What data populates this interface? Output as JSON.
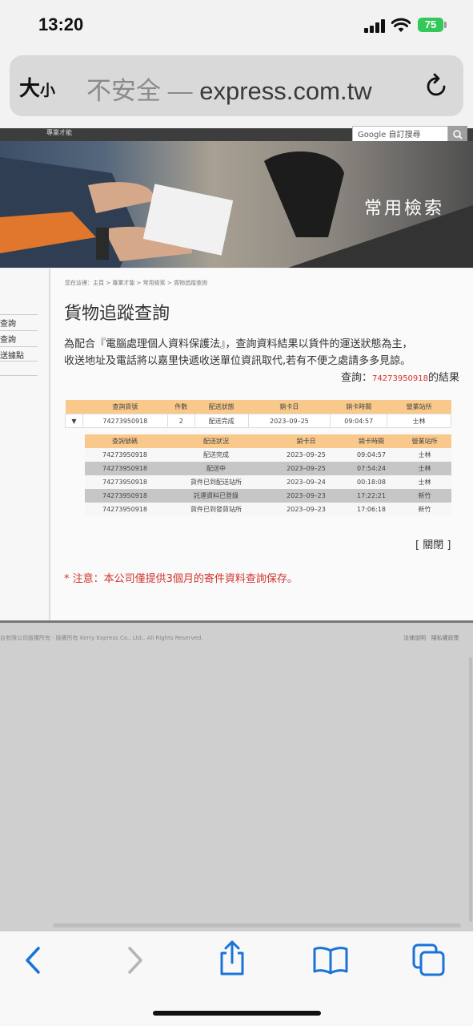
{
  "status_bar": {
    "time": "13:20",
    "battery": "75"
  },
  "browser": {
    "text_size": "大",
    "text_size_small": "小",
    "insecure_label": "不安全 —",
    "domain": "express.com.tw"
  },
  "site": {
    "topnav": "專業才能",
    "search_placeholder": "Google 自訂搜尋",
    "hero_title": "常用檢索",
    "sidebar": [
      "查詢",
      "查詢",
      "送據點"
    ],
    "breadcrumb": "您在這裡：主頁 > 專業才能 > 常用檢索 > 貨物追蹤查詢",
    "title": "貨物追蹤查詢",
    "notice_line1": "為配合『電腦處理個人資料保護法』，查詢資料結果以貨件的運送狀態為主，",
    "notice_line2": "收送地址及電話將以嘉里快遞收送單位資訊取代,若有不便之處請多多見諒。",
    "result_prefix": "查詢：",
    "result_number": "74273950918",
    "result_suffix": "的結果",
    "summary_headers": [
      "查詢貨號",
      "件數",
      "配送狀態",
      "銷卡日",
      "銷卡時間",
      "營業站所"
    ],
    "summary_row": {
      "number": "74273950918",
      "count": "2",
      "status": "配送完成",
      "date": "2023–09–25",
      "time": "09:04:57",
      "station": "士林"
    },
    "detail_headers": [
      "查詢號碼",
      "配送狀況",
      "銷卡日",
      "銷卡時間",
      "營業站所"
    ],
    "detail_rows": [
      {
        "number": "74273950918",
        "status": "配送完成",
        "date": "2023–09–25",
        "time": "09:04:57",
        "station": "士林"
      },
      {
        "number": "74273950918",
        "status": "配送中",
        "date": "2023–09–25",
        "time": "07:54:24",
        "station": "士林"
      },
      {
        "number": "74273950918",
        "status": "貨件已到配送站所",
        "date": "2023–09–24",
        "time": "00:18:08",
        "station": "士林"
      },
      {
        "number": "74273950918",
        "status": "託運資料已登錄",
        "date": "2023–09–23",
        "time": "17:22:21",
        "station": "新竹"
      },
      {
        "number": "74273950918",
        "status": "貨件已到發貨站所",
        "date": "2023–09–23",
        "time": "17:06:18",
        "station": "新竹"
      }
    ],
    "close_label": "[ 關閉 ]",
    "warning": "* 注意：本公司僅提供3個月的寄件資料查詢保存。",
    "footer_copyright": "台有限公司版權所有 · 版權所有 Kerry Express Co., Ltd., All Rights Reserved.",
    "footer_links": [
      "法律說明",
      "隱私權政策"
    ]
  },
  "toolbar": {
    "icons": [
      "back-icon",
      "forward-icon",
      "share-icon",
      "bookmarks-icon",
      "tabs-icon"
    ]
  },
  "colors": {
    "accent_red": "#d0342c",
    "header_orange": "#f9c98b",
    "ios_blue": "#1a73d9"
  }
}
